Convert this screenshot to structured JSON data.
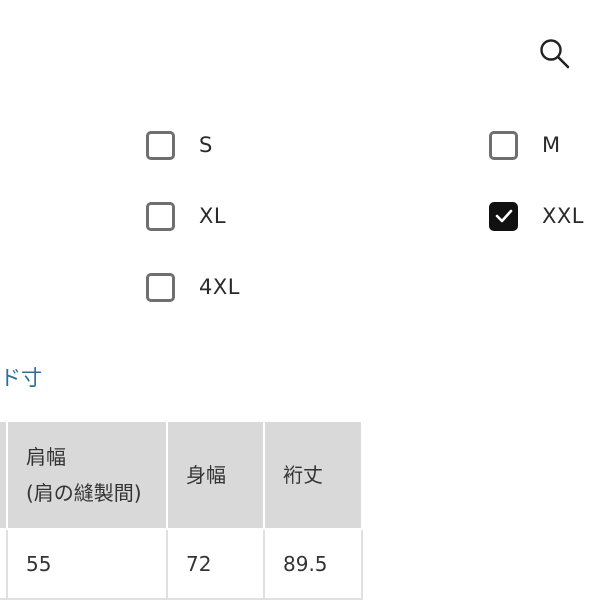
{
  "icons": {
    "search": "search-icon",
    "checkmark": "checkmark-icon"
  },
  "size_options": [
    {
      "label": "S",
      "checked": false
    },
    {
      "label": "M",
      "checked": false
    },
    {
      "label": "XL",
      "checked": false
    },
    {
      "label": "XXL",
      "checked": true
    },
    {
      "label": "4XL",
      "checked": false
    }
  ],
  "size_section": {
    "link_text": "ド寸"
  },
  "size_table": {
    "headers": [
      {
        "line1": "肩幅",
        "line2": "(肩の縫製間)"
      },
      {
        "line1": "身幅",
        "line2": ""
      },
      {
        "line1": "裄丈",
        "line2": ""
      }
    ],
    "rows": [
      [
        "55",
        "72",
        "89.5"
      ]
    ]
  },
  "colors": {
    "accent_link": "#2c6f9a",
    "checkbox_checked": "#111111",
    "header_bg": "#d9d9d9"
  }
}
